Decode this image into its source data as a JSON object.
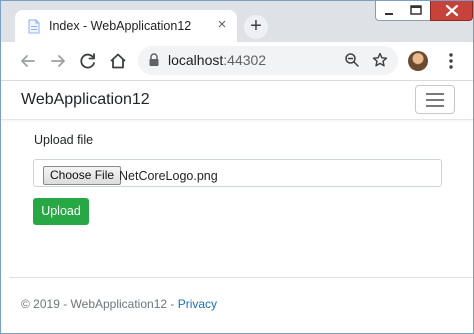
{
  "browser": {
    "tab_title": "Index - WebApplication12",
    "tab_close_glyph": "×",
    "new_tab_glyph": "+",
    "url_host": "localhost",
    "url_port": ":44302",
    "icons": [
      "back-icon",
      "forward-icon",
      "reload-icon",
      "home-icon",
      "lock-icon",
      "zoom-icon",
      "star-icon",
      "profile-avatar",
      "menu-icon"
    ]
  },
  "navbar": {
    "brand": "WebApplication12"
  },
  "form": {
    "label": "Upload file",
    "choose_button": "Choose File",
    "file_name": "NetCoreLogo.png",
    "upload_button": "Upload"
  },
  "footer": {
    "prefix": "© 2019 - WebApplication12 - ",
    "privacy_link": "Privacy"
  },
  "colors": {
    "upload_green": "#28a745",
    "link_blue": "#1b6ec2",
    "close_red": "#c7423b"
  }
}
